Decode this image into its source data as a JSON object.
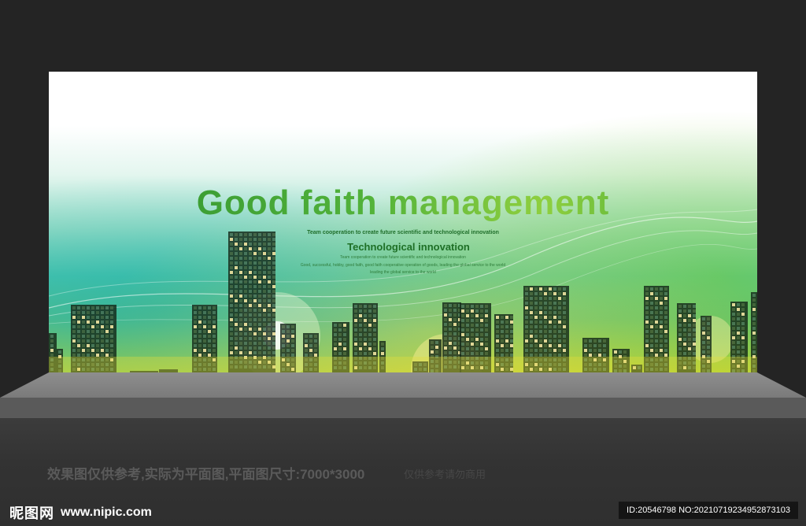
{
  "board": {
    "headline": "Good faith management",
    "tagline_1": "Team cooperation to create future scientific and technological innovation",
    "tagline_2": "Technological innovation",
    "tagline_3": "Team cooperation to create future scientific and technological innovation",
    "tagline_4": "Good, successful, hobby, good faith, good faith cooperative operation of goods, leading the global service to the world",
    "tagline_5": "leading the global service to the world"
  },
  "footer": {
    "note": "效果图仅供参考,实际为平面图,平面图尺寸:7000*3000",
    "note_faint": "仅供参考请勿商用",
    "logo_text": "昵图网",
    "logo_url": "www.nipic.com",
    "image_id": "ID:20546798 NO:20210719234952873103"
  },
  "colors": {
    "background": "#242424",
    "headline_green": "#2f9b37",
    "board_teal": "#52c9b3",
    "board_lime": "#b8d437"
  }
}
